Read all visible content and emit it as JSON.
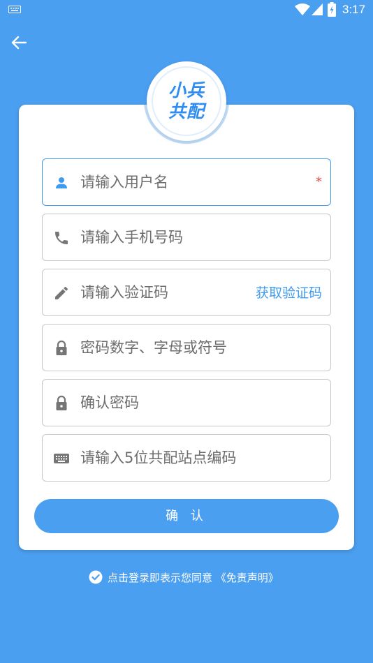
{
  "status_bar": {
    "time": "3:17",
    "icons": [
      "keyboard-icon",
      "wifi-icon",
      "signal-icon",
      "battery-icon"
    ]
  },
  "header": {
    "back_icon": "arrow-left-icon"
  },
  "logo": {
    "line1": "小兵",
    "line2": "共配"
  },
  "form": {
    "username": {
      "placeholder": "请输入用户名",
      "icon": "person-icon",
      "required_mark": "*"
    },
    "phone": {
      "placeholder": "请输入手机号码",
      "icon": "phone-icon"
    },
    "code": {
      "placeholder": "请输入验证码",
      "icon": "pencil-icon",
      "action_label": "获取验证码"
    },
    "password": {
      "placeholder": "密码数字、字母或符号",
      "icon": "lock-icon"
    },
    "confirm_password": {
      "placeholder": "确认密码",
      "icon": "lock-icon"
    },
    "site_code": {
      "placeholder": "请输入5位共配站点编码",
      "icon": "keyboard-icon"
    },
    "submit_label": "确 认"
  },
  "agreement": {
    "icon": "check-circle-icon",
    "text": "点击登录即表示您同意 《免责声明》"
  },
  "colors": {
    "background": "#4b9ff0",
    "accent": "#3f9bef",
    "required": "#e84a4a",
    "placeholder_text": "#6d6d6d"
  }
}
